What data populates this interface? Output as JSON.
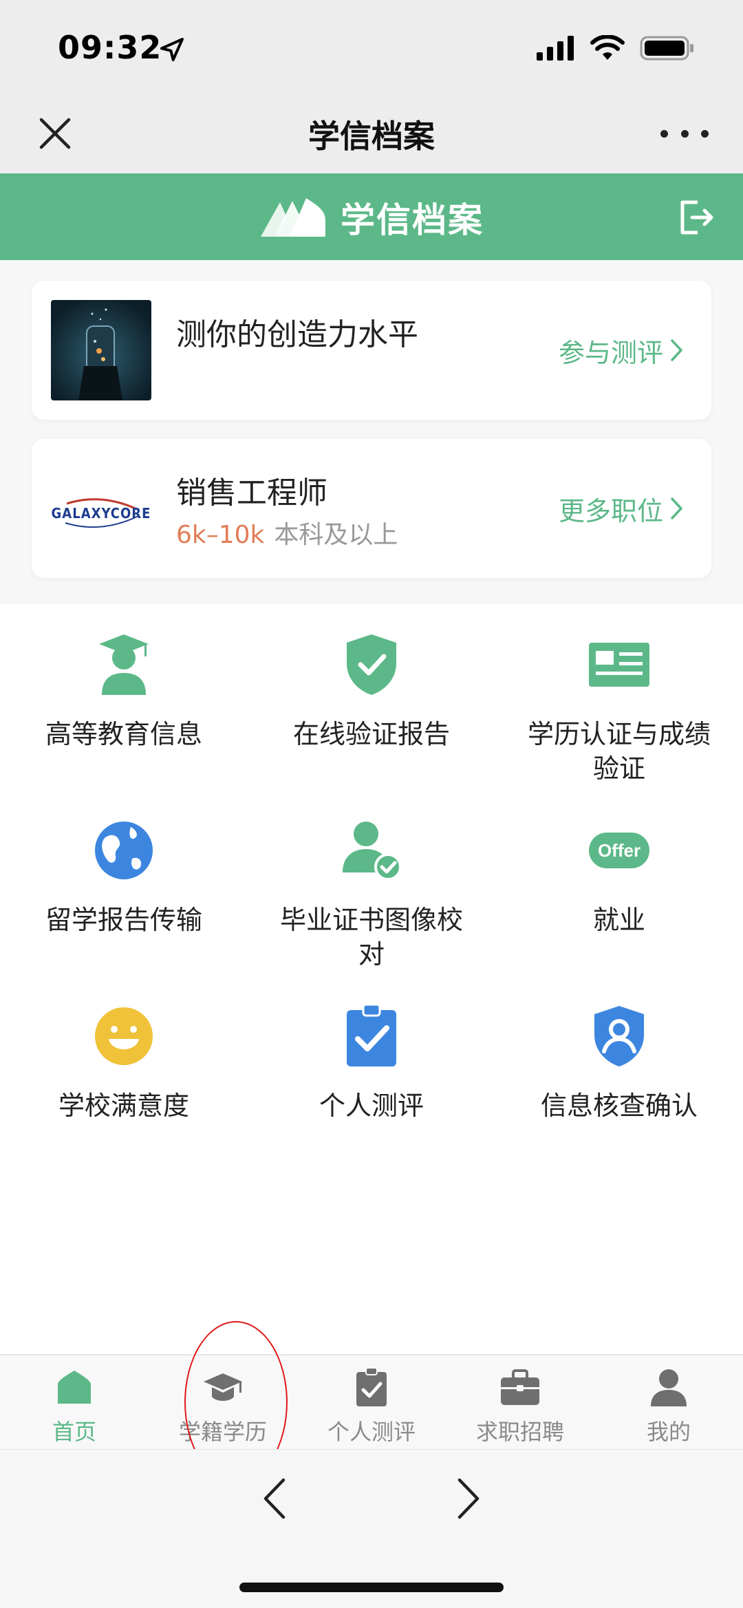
{
  "status": {
    "time": "09:32"
  },
  "nav": {
    "title": "学信档案"
  },
  "header": {
    "brand": "学信档案"
  },
  "cards": {
    "quiz": {
      "title": "测你的创造力水平",
      "action": "参与测评"
    },
    "job": {
      "title": "销售工程师",
      "salary": "6k–10k",
      "education": "本科及以上",
      "action": "更多职位",
      "company_logo_text": "GALAXYCORE"
    }
  },
  "grid": [
    {
      "label": "高等教育信息",
      "icon": "graduate-person-icon"
    },
    {
      "label": "在线验证报告",
      "icon": "shield-check-icon"
    },
    {
      "label": "学历认证与成绩验证",
      "icon": "id-card-icon"
    },
    {
      "label": "留学报告传输",
      "icon": "globe-icon"
    },
    {
      "label": "毕业证书图像校对",
      "icon": "person-check-icon"
    },
    {
      "label": "就业",
      "icon": "offer-icon"
    },
    {
      "label": "学校满意度",
      "icon": "smiley-icon"
    },
    {
      "label": "个人测评",
      "icon": "clipboard-check-icon"
    },
    {
      "label": "信息核查确认",
      "icon": "shield-user-icon"
    }
  ],
  "offer_text": "Offer",
  "tabs": [
    {
      "label": "首页",
      "icon": "home-icon",
      "active": true
    },
    {
      "label": "学籍学历",
      "icon": "graduation-cap-icon",
      "active": false
    },
    {
      "label": "个人测评",
      "icon": "clipboard-check-icon",
      "active": false
    },
    {
      "label": "求职招聘",
      "icon": "briefcase-icon",
      "active": false
    },
    {
      "label": "我的",
      "icon": "user-icon",
      "active": false
    }
  ],
  "colors": {
    "brand_green": "#5cb888",
    "salary_orange": "#e07c56",
    "icon_blue": "#3d86e0",
    "icon_yellow": "#f0c23a"
  }
}
